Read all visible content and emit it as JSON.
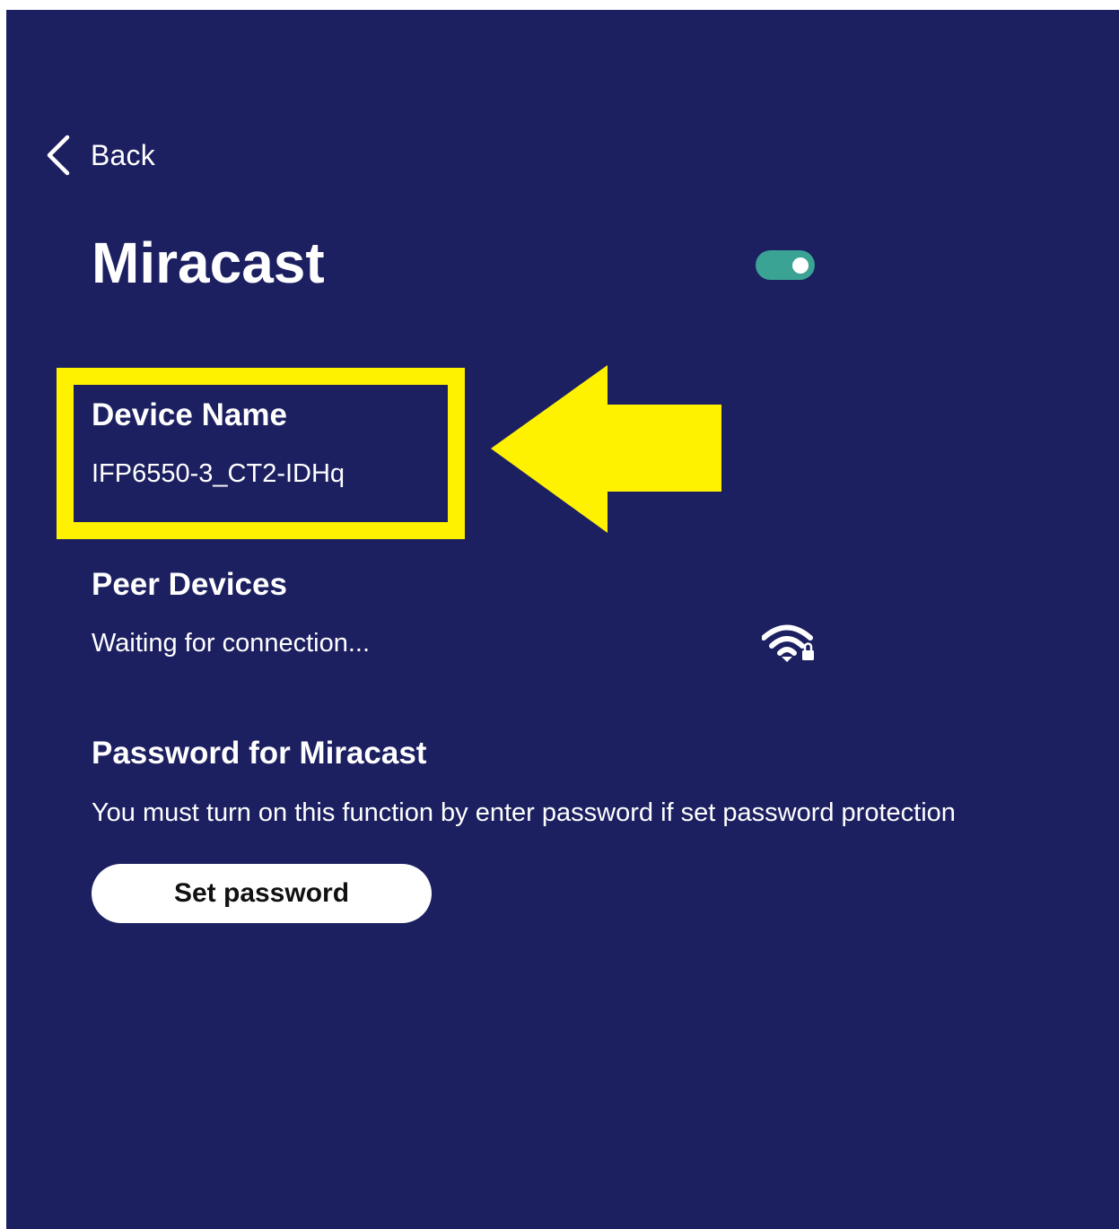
{
  "header": {
    "back_label": "Back",
    "back_icon": "chevron-left-icon"
  },
  "page": {
    "title": "Miracast",
    "toggle_state": "on",
    "toggle_color": "#3aa394",
    "background_color": "#1c2061"
  },
  "device_name": {
    "title": "Device Name",
    "value": "IFP6550-3_CT2-IDHq"
  },
  "peer_devices": {
    "title": "Peer Devices",
    "status": "Waiting for connection...",
    "icon": "wifi-lock-icon"
  },
  "password": {
    "title": "Password for Miracast",
    "description": "You must turn on this function by enter password if set password protection",
    "button_label": "Set password"
  },
  "annotation": {
    "highlight_color": "#fff200",
    "arrow_icon": "arrow-left-icon"
  }
}
